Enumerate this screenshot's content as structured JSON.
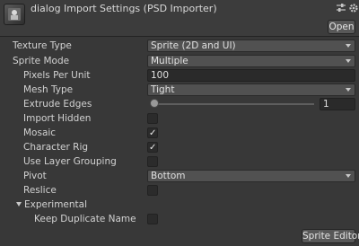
{
  "header": {
    "title": "dialog Import Settings (PSD Importer)",
    "icon": "psd-asset-icon",
    "open_label": "Open"
  },
  "settings": {
    "texture_type": {
      "label": "Texture Type",
      "value": "Sprite (2D and UI)"
    },
    "sprite_mode": {
      "label": "Sprite Mode",
      "value": "Multiple"
    },
    "pixels_per_unit": {
      "label": "Pixels Per Unit",
      "value": "100"
    },
    "mesh_type": {
      "label": "Mesh Type",
      "value": "Tight"
    },
    "extrude_edges": {
      "label": "Extrude Edges",
      "value": "1"
    },
    "import_hidden": {
      "label": "Import Hidden",
      "checked": false
    },
    "mosaic": {
      "label": "Mosaic",
      "checked": true,
      "mark": "✓"
    },
    "character_rig": {
      "label": "Character Rig",
      "checked": true,
      "mark": "✓"
    },
    "use_layer_grouping": {
      "label": "Use Layer Grouping",
      "checked": false
    },
    "pivot": {
      "label": "Pivot",
      "value": "Bottom"
    },
    "reslice": {
      "label": "Reslice",
      "checked": false
    }
  },
  "experimental": {
    "label": "Experimental",
    "keep_duplicate_name": {
      "label": "Keep Duplicate Name",
      "checked": false
    }
  },
  "footer": {
    "sprite_editor_label": "Sprite Editor"
  },
  "colors": {
    "background": "#383838",
    "field": "#2a2a2a",
    "dropdown": "#515151",
    "button": "#585858"
  }
}
